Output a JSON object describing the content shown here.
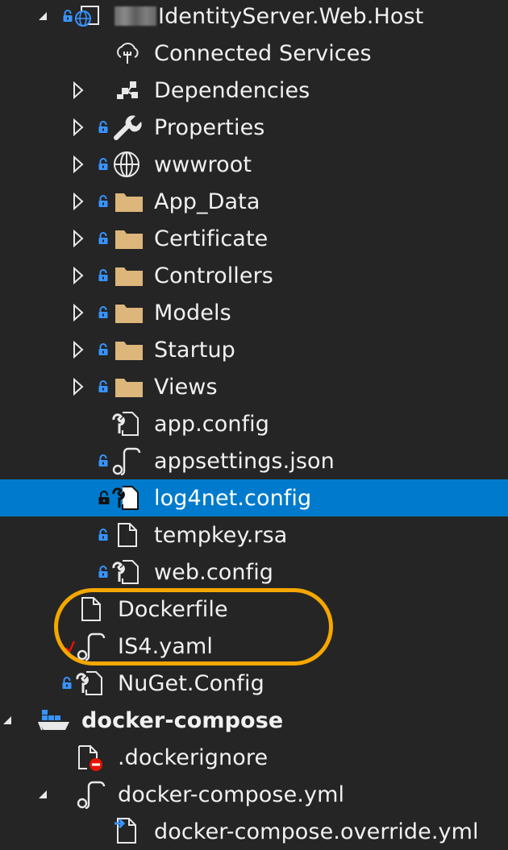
{
  "colors": {
    "background": "#252526",
    "selection": "#007acc",
    "text": "#f1f1f1",
    "lock": "#3794ff",
    "folder": "#dcb67a",
    "ring": "#f5a700",
    "error": "#e51400"
  },
  "tree": {
    "project_root": {
      "label": "IdentityServer.Web.Host",
      "icon": "globe-project-icon",
      "expanded": true
    },
    "items": [
      {
        "label": "Connected Services",
        "icon": "connected-services-icon"
      },
      {
        "label": "Dependencies",
        "icon": "dependencies-icon"
      },
      {
        "label": "Properties",
        "icon": "wrench-icon"
      },
      {
        "label": "wwwroot",
        "icon": "globe-icon"
      },
      {
        "label": "App_Data",
        "icon": "folder-icon"
      },
      {
        "label": "Certificate",
        "icon": "folder-icon"
      },
      {
        "label": "Controllers",
        "icon": "folder-icon"
      },
      {
        "label": "Models",
        "icon": "folder-icon"
      },
      {
        "label": "Startup",
        "icon": "folder-icon"
      },
      {
        "label": "Views",
        "icon": "folder-icon"
      },
      {
        "label": "app.config",
        "icon": "config-file-icon"
      },
      {
        "label": "appsettings.json",
        "icon": "json-file-icon"
      },
      {
        "label": "log4net.config",
        "icon": "config-file-icon",
        "selected": true
      },
      {
        "label": "tempkey.rsa",
        "icon": "file-icon"
      },
      {
        "label": "web.config",
        "icon": "config-file-icon"
      },
      {
        "label": "Dockerfile",
        "icon": "file-icon"
      },
      {
        "label": "IS4.yaml",
        "icon": "yaml-file-icon"
      },
      {
        "label": "NuGet.Config",
        "icon": "config-file-icon"
      }
    ],
    "compose_root": {
      "label": "docker-compose",
      "icon": "docker-compose-icon",
      "expanded": true
    },
    "compose_items": [
      {
        "label": ".dockerignore",
        "icon": "excluded-file-icon"
      },
      {
        "label": "docker-compose.yml",
        "icon": "yaml-file-icon",
        "expanded": true
      },
      {
        "label": "docker-compose.override.yml",
        "icon": "override-file-icon"
      }
    ]
  }
}
